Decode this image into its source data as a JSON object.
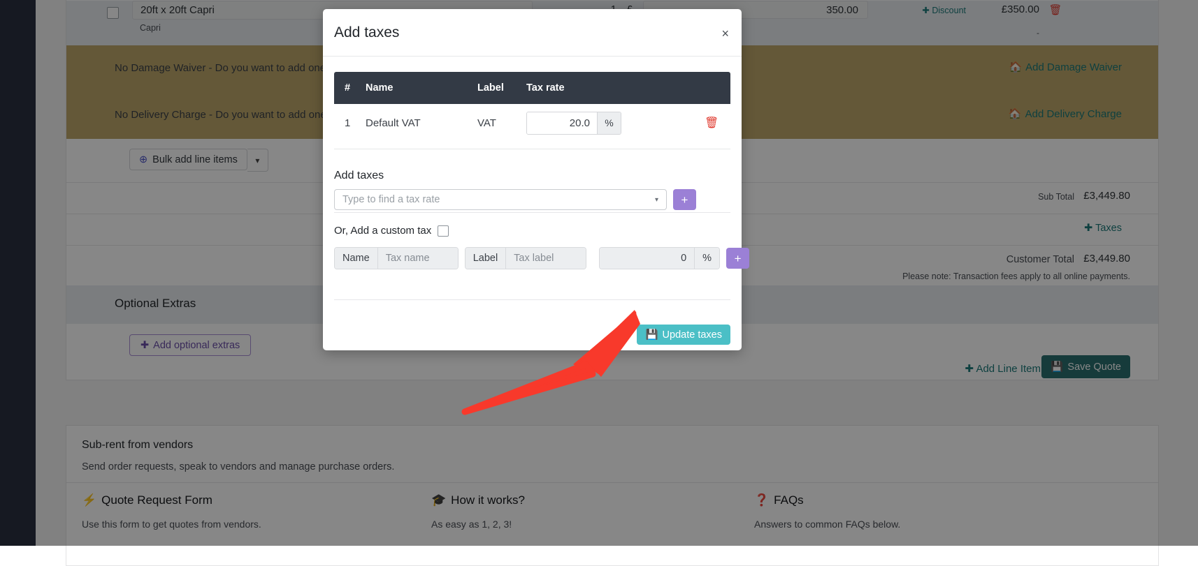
{
  "background": {
    "line_item": {
      "name": "20ft x 20ft Capri",
      "sub_name": "Capri",
      "qty": "1",
      "currency": "£",
      "price": "350.00",
      "discount_label": "Discount",
      "total": "£350.00",
      "total_sub": "-"
    },
    "warnings": [
      {
        "text": "No Damage Waiver - Do you want to add one?",
        "link": "Add Damage Waiver"
      },
      {
        "text": "No Delivery Charge - Do you want to add one?",
        "link": "Add Delivery Charge"
      }
    ],
    "bulk_add_label": "Bulk add line items",
    "totals": {
      "sub_total_label": "Sub Total",
      "sub_total_value": "£3,449.80",
      "taxes_link": "Taxes",
      "customer_total_label": "Customer Total",
      "customer_total_value": "£3,449.80",
      "note": "Please note: Transaction fees apply to all online payments."
    },
    "optional_extras": {
      "heading": "Optional Extras",
      "add_label": "Add optional extras"
    },
    "actions": {
      "add_line_item": "Add Line Item",
      "save_quote": "Save Quote"
    },
    "subrent": {
      "title": "Sub-rent from vendors",
      "description": "Send order requests, speak to vendors and manage purchase orders.",
      "columns": [
        {
          "heading": "Quote Request Form",
          "icon": "bolt-icon",
          "description": "Use this form to get quotes from vendors."
        },
        {
          "heading": "How it works?",
          "icon": "graduation-cap-icon",
          "description": "As easy as 1, 2, 3!"
        },
        {
          "heading": "FAQs",
          "icon": "question-circle-icon",
          "description": "Answers to common FAQs below."
        }
      ]
    }
  },
  "modal": {
    "title": "Add taxes",
    "close_label": "×",
    "table": {
      "headers": [
        "#",
        "Name",
        "Label",
        "Tax rate"
      ],
      "rows": [
        {
          "num": "1",
          "name": "Default VAT",
          "label": "VAT",
          "rate": "20.0",
          "unit": "%"
        }
      ]
    },
    "add_section": {
      "title": "Add taxes",
      "select_placeholder": "Type to find a tax rate",
      "add_button_label": "+"
    },
    "custom_section": {
      "label": "Or, Add a custom tax",
      "name_addon": "Name",
      "name_placeholder": "Tax name",
      "label_addon": "Label",
      "label_placeholder": "Tax label",
      "rate_value": "0",
      "rate_unit": "%",
      "add_button_label": "+"
    },
    "footer": {
      "update_label": "Update taxes"
    }
  },
  "colors": {
    "modal_header_table": "#333a45",
    "accent_teal": "#4bbfc6",
    "accent_purple": "#9b80d6",
    "link_teal": "#1c7a7a",
    "danger_red": "#e03a2f",
    "arrow_red": "#f8392b"
  }
}
